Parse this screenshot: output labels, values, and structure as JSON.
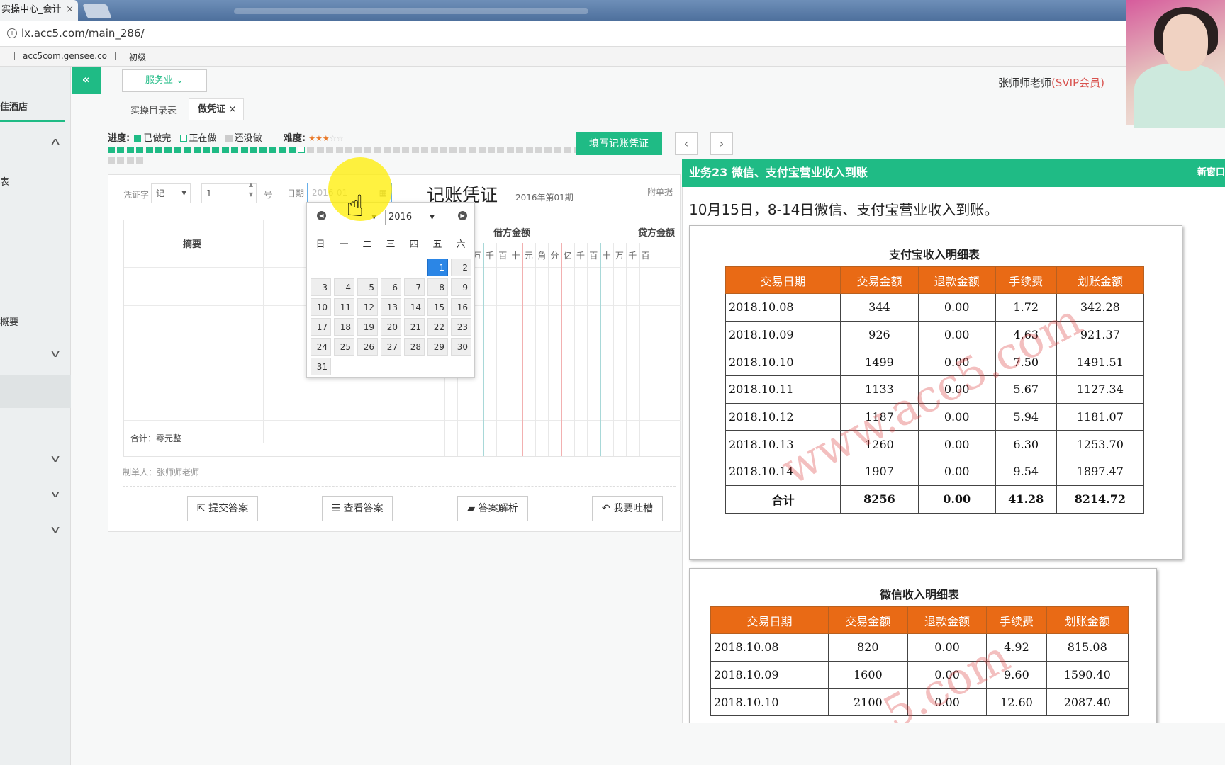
{
  "browser": {
    "tab_title": "实操中心_会计",
    "tab_close": "×",
    "url": "lx.acc5.com/main_286/",
    "bookmarks": [
      "acc5com.gensee.co",
      "初级"
    ]
  },
  "sidebar": {
    "title": "佳酒店",
    "items": [
      "表",
      "概要"
    ]
  },
  "header": {
    "collapse_icon": "«",
    "industry": "服务业",
    "user": "张师师老师",
    "badge": "(SVIP会员)"
  },
  "tabs": [
    "实操目录表",
    "做凭证"
  ],
  "progress": {
    "label": "进度:",
    "done": "已做完",
    "doing": "正在做",
    "todo": "还没做",
    "difficulty_label": "难度:",
    "stars": "★★★",
    "completed_fraction": 0.33,
    "colors": {
      "done": "#1fbb85",
      "doing": "#ffffff",
      "todo": "#d4d4d4"
    }
  },
  "toolbar": {
    "fill_voucher": "填写记账凭证",
    "prev": "‹",
    "next": "›"
  },
  "voucher": {
    "word_label": "凭证字",
    "word_value": "记",
    "number_value": "1",
    "number_suffix": "号",
    "date_label": "日期",
    "date_value": "2016-01-",
    "title": "记账凭证",
    "period": "2016年第01期",
    "attach_label": "附单据",
    "col_summary": "摘要",
    "col_debit": "借方金额",
    "col_credit": "贷方金额",
    "digits": [
      "百",
      "十",
      "万",
      "千",
      "百",
      "十",
      "元",
      "角",
      "分",
      "亿",
      "千",
      "百",
      "十",
      "万",
      "千",
      "百"
    ],
    "total": "合计：零元整",
    "maker": "制单人：张师师老师",
    "buttons": [
      "提交答案",
      "查看答案",
      "答案解析",
      "我要吐槽"
    ]
  },
  "calendar": {
    "year": "2016",
    "weekdays": [
      "日",
      "一",
      "二",
      "三",
      "四",
      "五",
      "六"
    ],
    "days": [
      "1",
      "2",
      "3",
      "4",
      "5",
      "6",
      "7",
      "8",
      "9",
      "10",
      "11",
      "12",
      "13",
      "14",
      "15",
      "16",
      "17",
      "18",
      "19",
      "20",
      "21",
      "22",
      "23",
      "24",
      "25",
      "26",
      "27",
      "28",
      "29",
      "30",
      "31"
    ],
    "selected": "1"
  },
  "panel": {
    "title": "业务23 微信、支付宝营业收入到账",
    "new_window": "新窗口",
    "description": "10月15日，8-14日微信、支付宝营业收入到账。",
    "watermark": "www.acc5.com",
    "alipay": {
      "title": "支付宝收入明细表",
      "headers": [
        "交易日期",
        "交易金额",
        "退款金额",
        "手续费",
        "划账金额"
      ],
      "rows": [
        [
          "2018.10.08",
          "344",
          "0.00",
          "1.72",
          "342.28"
        ],
        [
          "2018.10.09",
          "926",
          "0.00",
          "4.63",
          "921.37"
        ],
        [
          "2018.10.10",
          "1499",
          "0.00",
          "7.50",
          "1491.51"
        ],
        [
          "2018.10.11",
          "1133",
          "0.00",
          "5.67",
          "1127.34"
        ],
        [
          "2018.10.12",
          "1187",
          "0.00",
          "5.94",
          "1181.07"
        ],
        [
          "2018.10.13",
          "1260",
          "0.00",
          "6.30",
          "1253.70"
        ],
        [
          "2018.10.14",
          "1907",
          "0.00",
          "9.54",
          "1897.47"
        ]
      ],
      "total": [
        "合计",
        "8256",
        "0.00",
        "41.28",
        "8214.72"
      ]
    },
    "wechat": {
      "title": "微信收入明细表",
      "headers": [
        "交易日期",
        "交易金额",
        "退款金额",
        "手续费",
        "划账金额"
      ],
      "rows": [
        [
          "2018.10.08",
          "820",
          "0.00",
          "4.92",
          "815.08"
        ],
        [
          "2018.10.09",
          "1600",
          "0.00",
          "9.60",
          "1590.40"
        ],
        [
          "2018.10.10",
          "2100",
          "0.00",
          "12.60",
          "2087.40"
        ]
      ]
    }
  }
}
